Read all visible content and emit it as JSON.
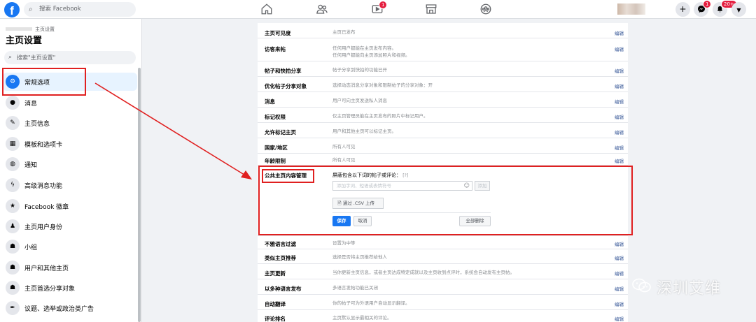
{
  "topbar": {
    "search_placeholder": "搜索 Facebook",
    "video_badge": "1",
    "messenger_badge": "1",
    "notif_badge": "20+"
  },
  "sidebar": {
    "breadcrumb": "主页设置",
    "title": "主页设置",
    "search_placeholder": "搜索\"主页设置\"",
    "items": [
      {
        "label": "常规选项",
        "icon": "gear-icon"
      },
      {
        "label": "消息",
        "icon": "chat-icon"
      },
      {
        "label": "主页信息",
        "icon": "pencil-icon"
      },
      {
        "label": "模板和选项卡",
        "icon": "grid-icon"
      },
      {
        "label": "通知",
        "icon": "globe-icon"
      },
      {
        "label": "高级消息功能",
        "icon": "messenger-icon"
      },
      {
        "label": "Facebook 徽章",
        "icon": "star-badge-icon"
      },
      {
        "label": "主页用户身份",
        "icon": "person-icon"
      },
      {
        "label": "小组",
        "icon": "group-icon"
      },
      {
        "label": "用户和其他主页",
        "icon": "people-icon"
      },
      {
        "label": "主页首选分享对象",
        "icon": "people-icon"
      },
      {
        "label": "议题、选举或政治类广告",
        "icon": "pen-nib-icon"
      }
    ]
  },
  "settings": {
    "edit_label": "编辑",
    "rows_top": [
      {
        "key": "主页可见度",
        "value": "主页已发布"
      },
      {
        "key": "访客来帖",
        "value": "任何用户都能在主页发布内容。\n任何用户都能向主页添加照片和视频。"
      },
      {
        "key": "帖子和快拍分享",
        "value": "帖子分享到快拍的功能已开"
      },
      {
        "key": "优化帖子分享对象",
        "value": "选择动态消息分享对象和限制帖子的分享对象：开"
      },
      {
        "key": "消息",
        "value": "用户可向主页发送私人消息"
      },
      {
        "key": "标记权限",
        "value": "仅主页管理员能在主页发布的照片中标记用户。"
      },
      {
        "key": "允许标记主页",
        "value": "用户和其他主页可以标记主页。"
      },
      {
        "key": "国家/地区",
        "value": "所有人可见"
      },
      {
        "key": "年龄限制",
        "value": "所有人可见"
      }
    ],
    "moderation": {
      "label": "公共主页内容管理",
      "desc": "屏蔽包含以下词的帖子或评论：",
      "help": "[?]",
      "input_placeholder": "添加字词、短语或表情符号",
      "add_label": "添加",
      "csv_label": "通过 .CSV 上传",
      "save_label": "保存",
      "cancel_label": "取消",
      "delete_all_label": "全部删除"
    },
    "rows_bottom": [
      {
        "key": "不雅语言过滤",
        "value": "设置为中等"
      },
      {
        "key": "类似主页推荐",
        "value": "选择是否将主页推荐给他人"
      },
      {
        "key": "主页更新",
        "value": "当你更新主页信息，或者主页达成特定成就以及主页收到点评时，系统会自动发布主页帖。"
      },
      {
        "key": "以多种语言发布",
        "value": "多语言发帖功能已关闭"
      },
      {
        "key": "自动翻译",
        "value": "你的帖子可为外语用户自动显示翻译。"
      },
      {
        "key": "评论排名",
        "value": "主页默认显示最相关的评论。"
      }
    ]
  },
  "watermark": "深圳艾维",
  "colors": {
    "accent": "#1877f2",
    "annotation": "#e02020"
  }
}
